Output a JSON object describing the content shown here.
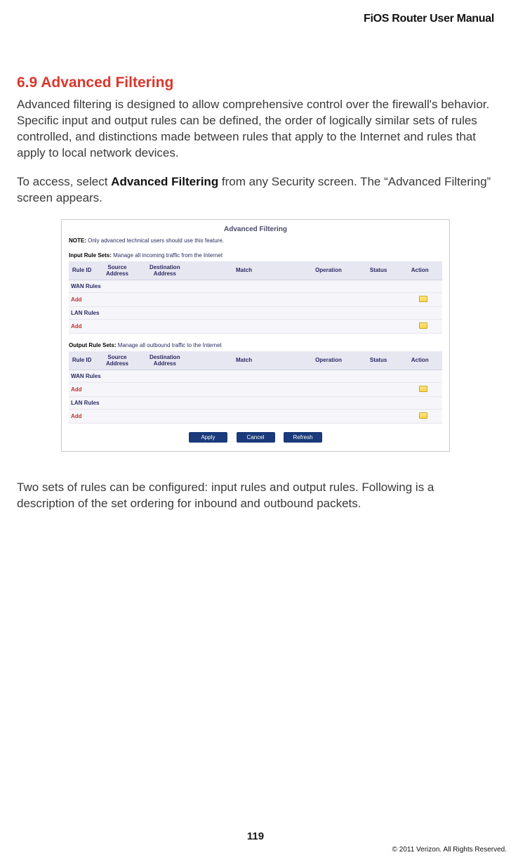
{
  "header": {
    "manual_title": "FiOS Router User Manual"
  },
  "section": {
    "heading": "6.9  Advanced Filtering",
    "para1": "Advanced filtering is designed to allow comprehensive control over the firewall's behavior. Specific input and output rules can be defined, the order of logically similar sets of rules controlled, and distinctions made between rules that apply to the Internet and rules that apply to local network devices.",
    "para2_pre": "To access, select ",
    "para2_bold": "Advanced Filtering",
    "para2_post": " from any Security screen. The “Advanced Filtering” screen appears.",
    "para3": "Two sets of rules can be configured: input rules and output rules. Following is a description of the set ordering for inbound and outbound packets."
  },
  "screenshot": {
    "title": "Advanced Filtering",
    "note_label": "NOTE:",
    "note_text": " Only advanced technical users should use this feature.",
    "input": {
      "label": "Input Rule Sets:",
      "desc": " Manage all incoming traffic from the Internet"
    },
    "output": {
      "label": "Output Rule Sets:",
      "desc": " Manage all outbound traffic to the Internet"
    },
    "columns": {
      "rule_id": "Rule ID",
      "source": "Source Address",
      "dest": "Destination Address",
      "match": "Match",
      "operation": "Operation",
      "status": "Status",
      "action": "Action"
    },
    "rows": {
      "wan_rules": "WAN Rules",
      "lan_rules": "LAN Rules",
      "add": "Add"
    },
    "buttons": {
      "apply": "Apply",
      "cancel": "Cancel",
      "refresh": "Refresh"
    }
  },
  "footer": {
    "page_number": "119",
    "copyright": "© 2011 Verizon. All Rights Reserved."
  }
}
